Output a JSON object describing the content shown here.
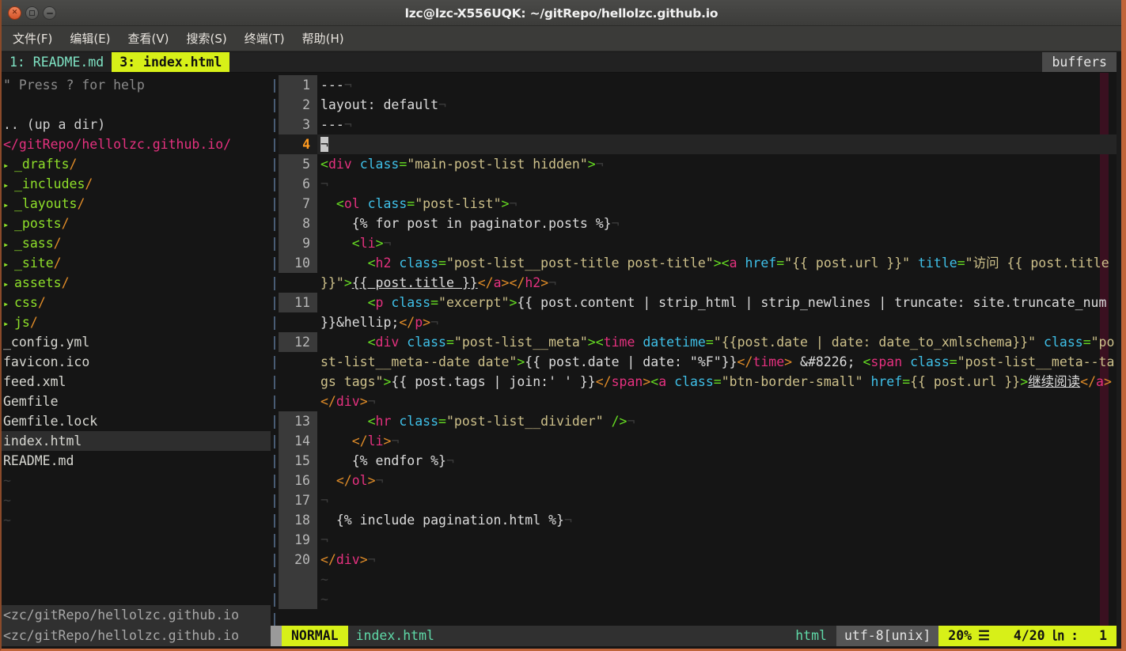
{
  "window": {
    "title": "lzc@lzc-X556UQK: ~/gitRepo/hellolzc.github.io",
    "buttons": [
      {
        "name": "close",
        "glyph": "×"
      },
      {
        "name": "maximize",
        "glyph": ""
      },
      {
        "name": "minimize",
        "glyph": ""
      }
    ]
  },
  "menubar": {
    "items": [
      {
        "label": "文件(F)",
        "name": "menu-file"
      },
      {
        "label": "编辑(E)",
        "name": "menu-edit"
      },
      {
        "label": "查看(V)",
        "name": "menu-view"
      },
      {
        "label": "搜索(S)",
        "name": "menu-search"
      },
      {
        "label": "终端(T)",
        "name": "menu-terminal"
      },
      {
        "label": "帮助(H)",
        "name": "menu-help"
      }
    ]
  },
  "tabline": {
    "buffers": [
      {
        "label": "1: README.md",
        "active": false
      },
      {
        "label": "3: index.html",
        "active": true
      }
    ],
    "right_label": "buffers"
  },
  "tree": {
    "help_hint": "\" Press ? for help",
    "up_a_dir": ".. (up a dir)",
    "root": "</gitRepo/hellolzc.github.io/",
    "arrow_glyph": "▸",
    "dirs": [
      "_drafts",
      "_includes",
      "_layouts",
      "_posts",
      "_sass",
      "_site",
      "assets",
      "css",
      "js"
    ],
    "files": [
      {
        "name": "_config.yml",
        "selected": false
      },
      {
        "name": "favicon.ico",
        "selected": false
      },
      {
        "name": "feed.xml",
        "selected": false
      },
      {
        "name": "Gemfile",
        "selected": false
      },
      {
        "name": "Gemfile.lock",
        "selected": false
      },
      {
        "name": "index.html",
        "selected": true
      },
      {
        "name": "README.md",
        "selected": false
      }
    ],
    "tilde_count": 3,
    "status_path": "<zc/gitRepo/hellolzc.github.io"
  },
  "editor": {
    "eol_glyph": "¬",
    "tilde_glyph": "~",
    "separator_glyph": "|",
    "total_lines": 20,
    "lines": [
      {
        "n": "1",
        "current": false
      },
      {
        "n": "2",
        "current": false
      },
      {
        "n": "3",
        "current": false
      },
      {
        "n": "4",
        "current": true
      },
      {
        "n": "5",
        "current": false
      },
      {
        "n": "6",
        "current": false
      },
      {
        "n": "7",
        "current": false
      },
      {
        "n": "8",
        "current": false
      },
      {
        "n": "9",
        "current": false
      },
      {
        "n": "10",
        "current": false
      },
      {
        "n": "11",
        "current": false
      },
      {
        "n": "12",
        "current": false
      },
      {
        "n": "13",
        "current": false
      },
      {
        "n": "14",
        "current": false
      },
      {
        "n": "15",
        "current": false
      },
      {
        "n": "16",
        "current": false
      },
      {
        "n": "17",
        "current": false
      },
      {
        "n": "18",
        "current": false
      },
      {
        "n": "19",
        "current": false
      },
      {
        "n": "20",
        "current": false
      }
    ],
    "source": [
      "---",
      "layout: default",
      "---",
      "",
      "<div class=\"main-post-list hidden\">",
      "",
      "  <ol class=\"post-list\">",
      "    {% for post in paginator.posts %}",
      "    <li>",
      "      <h2 class=\"post-list__post-title post-title\"><a href=\"{{ post.url }}\" title=\"访问 {{ post.title }}\">{{ post.title }}</a></h2>",
      "      <p class=\"excerpt\">{{ post.content | strip_html | strip_newlines | truncate: site.truncate_num }}&hellip;</p>",
      "      <div class=\"post-list__meta\"><time datetime=\"{{post.date | date: date_to_xmlschema}}\" class=\"post-list__meta--date date\">{{ post.date | date: \"%F\"}}</time> &#8226; <span class=\"post-list__meta--tags tags\">{{ post.tags | join:' ' }}</span><a class=\"btn-border-small\" href={{ post.url }}>继续阅读</a></div>",
      "      <hr class=\"post-list__divider\" />",
      "    </li>",
      "    {% endfor %}",
      "  </ol>",
      "",
      "  {% include pagination.html %}",
      "",
      "</div>"
    ]
  },
  "statusline": {
    "path": "<zc/gitRepo/hellolzc.github.io",
    "mode": "NORMAL",
    "filename": "index.html",
    "filetype": "html",
    "encoding": "utf-8[unix]",
    "percent": "20%",
    "percent_icon": "☰",
    "position": "4/20",
    "line_icon": "㏑",
    "colon": ":",
    "column": "1"
  },
  "colors": {
    "accent_yellow": "#d7f018",
    "tag_pink": "#e5317f",
    "attr_cyan": "#3fc0e8",
    "string_khaki": "#cdc08a",
    "bracket_green": "#66dd22",
    "dir_green": "#8fe02a",
    "slash_orange": "#e08c28",
    "root_magenta": "#e5317f",
    "window_border": "#c0653a",
    "colorcolumn": "#3a1020"
  }
}
